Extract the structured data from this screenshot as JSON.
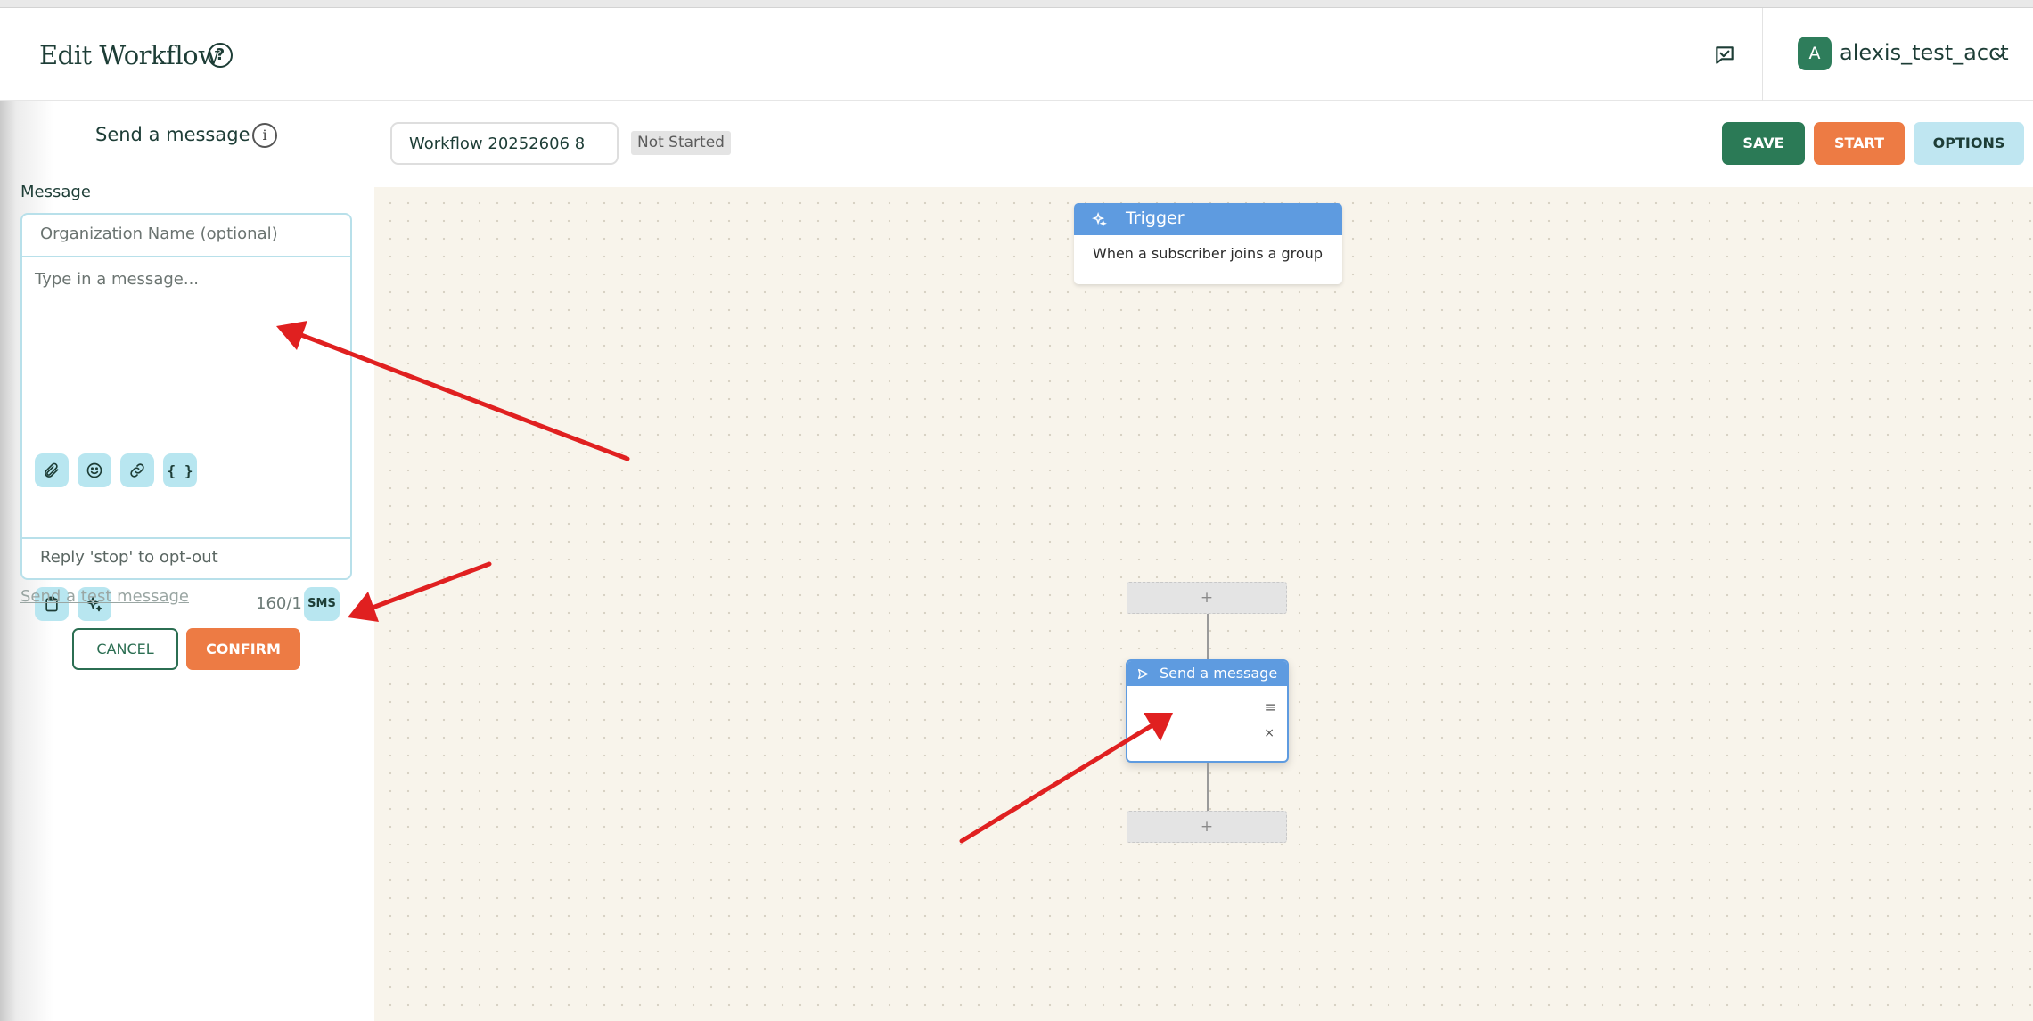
{
  "header": {
    "title": "Edit Workflow",
    "account_initial": "A",
    "account_name": "alexis_test_acct"
  },
  "panel": {
    "title": "Send a message",
    "message_label": "Message",
    "org_placeholder": "Organization Name (optional)",
    "message_placeholder": "Type in a message...",
    "braces_label": "{ }",
    "char_count": "160/1",
    "sms_badge": "SMS",
    "optout_text": "Reply 'stop' to opt-out",
    "test_link": "Send a test message",
    "cancel_label": "CANCEL",
    "confirm_label": "CONFIRM"
  },
  "toolbar": {
    "workflow_name": "Workflow 20252606 8",
    "status": "Not Started",
    "save_label": "SAVE",
    "start_label": "START",
    "options_label": "OPTIONS"
  },
  "canvas": {
    "trigger_title": "Trigger",
    "trigger_desc": "When a subscriber joins a group",
    "add_symbol": "+",
    "send_node_title": "Send a message",
    "menu_symbol": "≡",
    "close_symbol": "×"
  },
  "colors": {
    "brand_green": "#2b7a56",
    "accent_orange": "#ed7b44",
    "node_blue": "#5e9be0",
    "canvas_bg": "#f8f4eb",
    "annotation_red": "#e02020"
  }
}
